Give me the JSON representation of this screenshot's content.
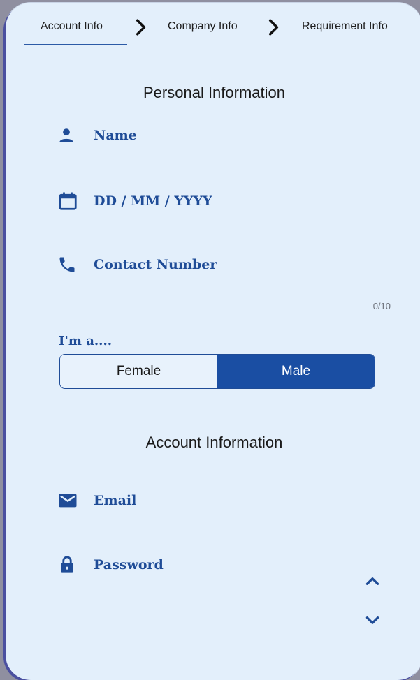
{
  "stepper": {
    "steps": [
      {
        "label": "Account Info"
      },
      {
        "label": "Company Info"
      },
      {
        "label": "Requirement Info"
      }
    ]
  },
  "personal": {
    "title": "Personal Information",
    "name_placeholder": "Name",
    "dob_placeholder": "DD / MM / YYYY",
    "phone_placeholder": "Contact Number",
    "phone_counter": "0/10"
  },
  "gender": {
    "label": "I'm a....",
    "options": [
      "Female",
      "Male"
    ],
    "selected": "Male"
  },
  "account": {
    "title": "Account Information",
    "email_placeholder": "Email",
    "password_placeholder": "Password"
  },
  "colors": {
    "accent": "#1f4c97",
    "selected_fill": "#1a4ea3",
    "background": "#e3effb"
  }
}
